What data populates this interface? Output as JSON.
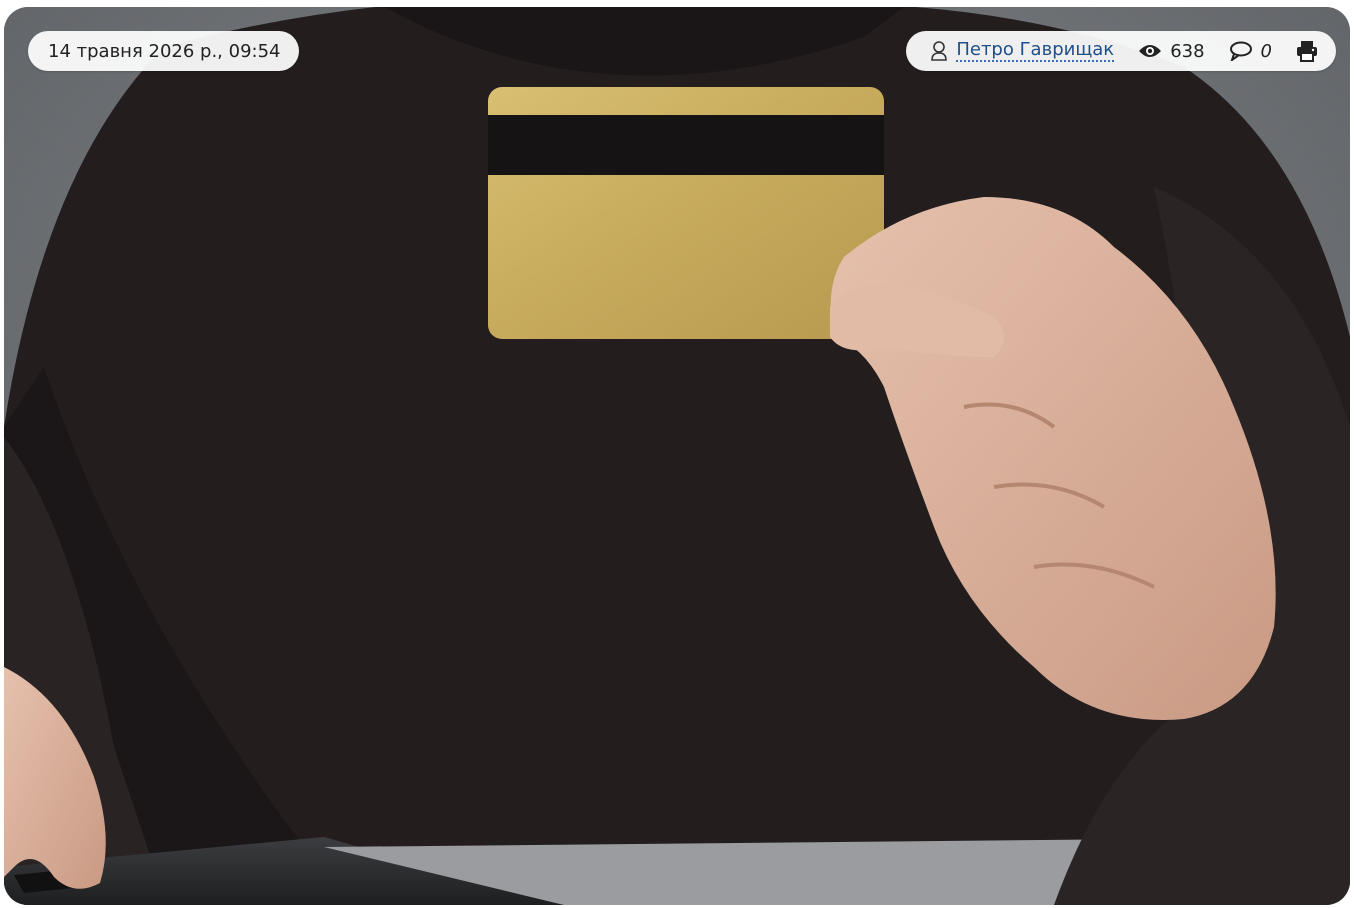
{
  "article": {
    "date": "14 травня 2026 р., 09:54",
    "author": "Петро Гаврищак",
    "views": "638",
    "comments": "0"
  },
  "icons": {
    "author": "user-icon",
    "views": "eye-icon",
    "comments": "comment-icon",
    "print": "print-icon"
  },
  "colors": {
    "author_link": "#1d4f8a",
    "card_gold": "#c9ad62",
    "sweater": "#231d1e",
    "background": "#6b6e72"
  }
}
